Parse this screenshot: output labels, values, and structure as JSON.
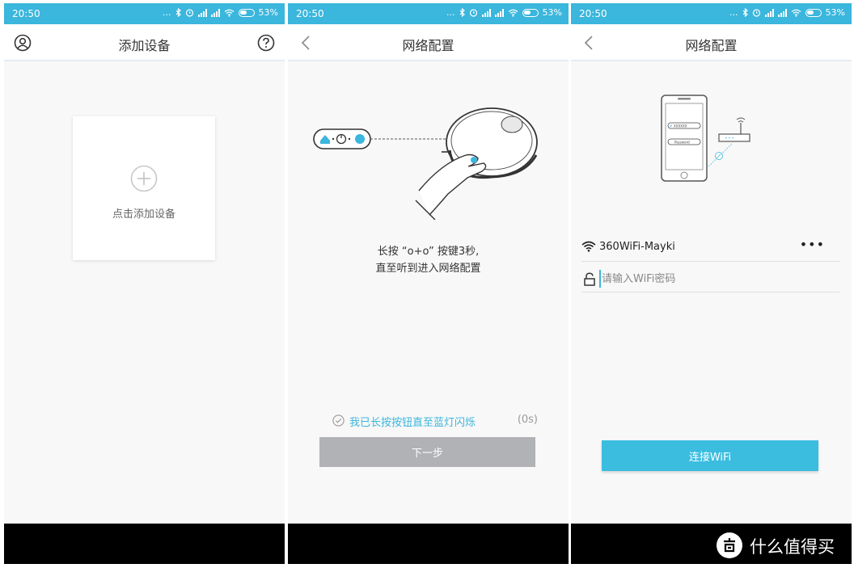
{
  "status_bar": {
    "time": "20:50",
    "dots": "...",
    "battery_percent": "53%"
  },
  "screen1": {
    "title": "添加设备",
    "add_label": "点击添加设备"
  },
  "screen2": {
    "title": "网络配置",
    "instruction_line1": "长按 “o+o” 按键3秒,",
    "instruction_line2": "直至听到进入网络配置",
    "confirm_text": "我已长按按钮直至蓝灯闪烁",
    "countdown": "(0s)",
    "next_label": "下一步"
  },
  "screen3": {
    "title": "网络配置",
    "illustration_field_text": "XXXXXX",
    "illustration_password": "Password",
    "ssid": "360WiFi-Mayki",
    "more_label": "•••",
    "password_placeholder": "请输入WiFi密码",
    "connect_label": "连接WiFi"
  },
  "watermark": {
    "text": "什么值得买"
  },
  "colors": {
    "accent": "#3bb6dc",
    "button_disabled": "#b0b2b6",
    "button_primary": "#3bbde0"
  }
}
